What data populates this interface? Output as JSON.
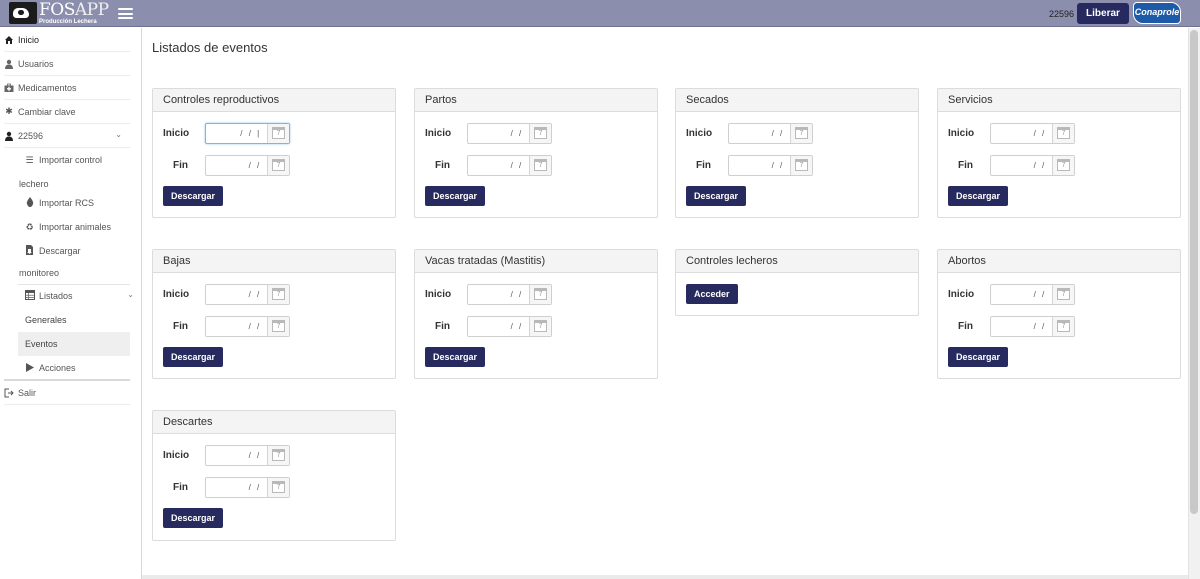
{
  "header": {
    "logo_title_a": "FOS",
    "logo_title_b": "APP",
    "logo_subtitle": "Producción Lechera",
    "user_code": "22596",
    "liberar_label": "Liberar",
    "brand_badge": "Conaprole"
  },
  "sidebar": {
    "inicio": "Inicio",
    "usuarios": "Usuarios",
    "medicamentos": "Medicamentos",
    "cambiar_clave": "Cambiar clave",
    "user": "22596",
    "importar_control_a": "Importar control",
    "importar_control_b": "lechero",
    "importar_rcs": "Importar RCS",
    "importar_animales": "Importar animales",
    "descargar_a": "Descargar",
    "descargar_b": "monitoreo",
    "listados": "Listados",
    "generales": "Generales",
    "eventos": "Eventos",
    "acciones": "Acciones",
    "salir": "Salir"
  },
  "main": {
    "title": "Listados de eventos",
    "inicio_label": "Inicio",
    "fin_label": "Fin",
    "date_mask": "/ /",
    "descargar_label": "Descargar",
    "acceder_label": "Acceder",
    "cal_day": "7",
    "cards": {
      "controles_reproductivos": "Controles reproductivos",
      "partos": "Partos",
      "secados": "Secados",
      "servicios": "Servicios",
      "bajas": "Bajas",
      "vacas_tratadas": "Vacas tratadas (Mastitis)",
      "controles_lecheros": "Controles lecheros",
      "abortos": "Abortos",
      "descartes": "Descartes"
    }
  }
}
